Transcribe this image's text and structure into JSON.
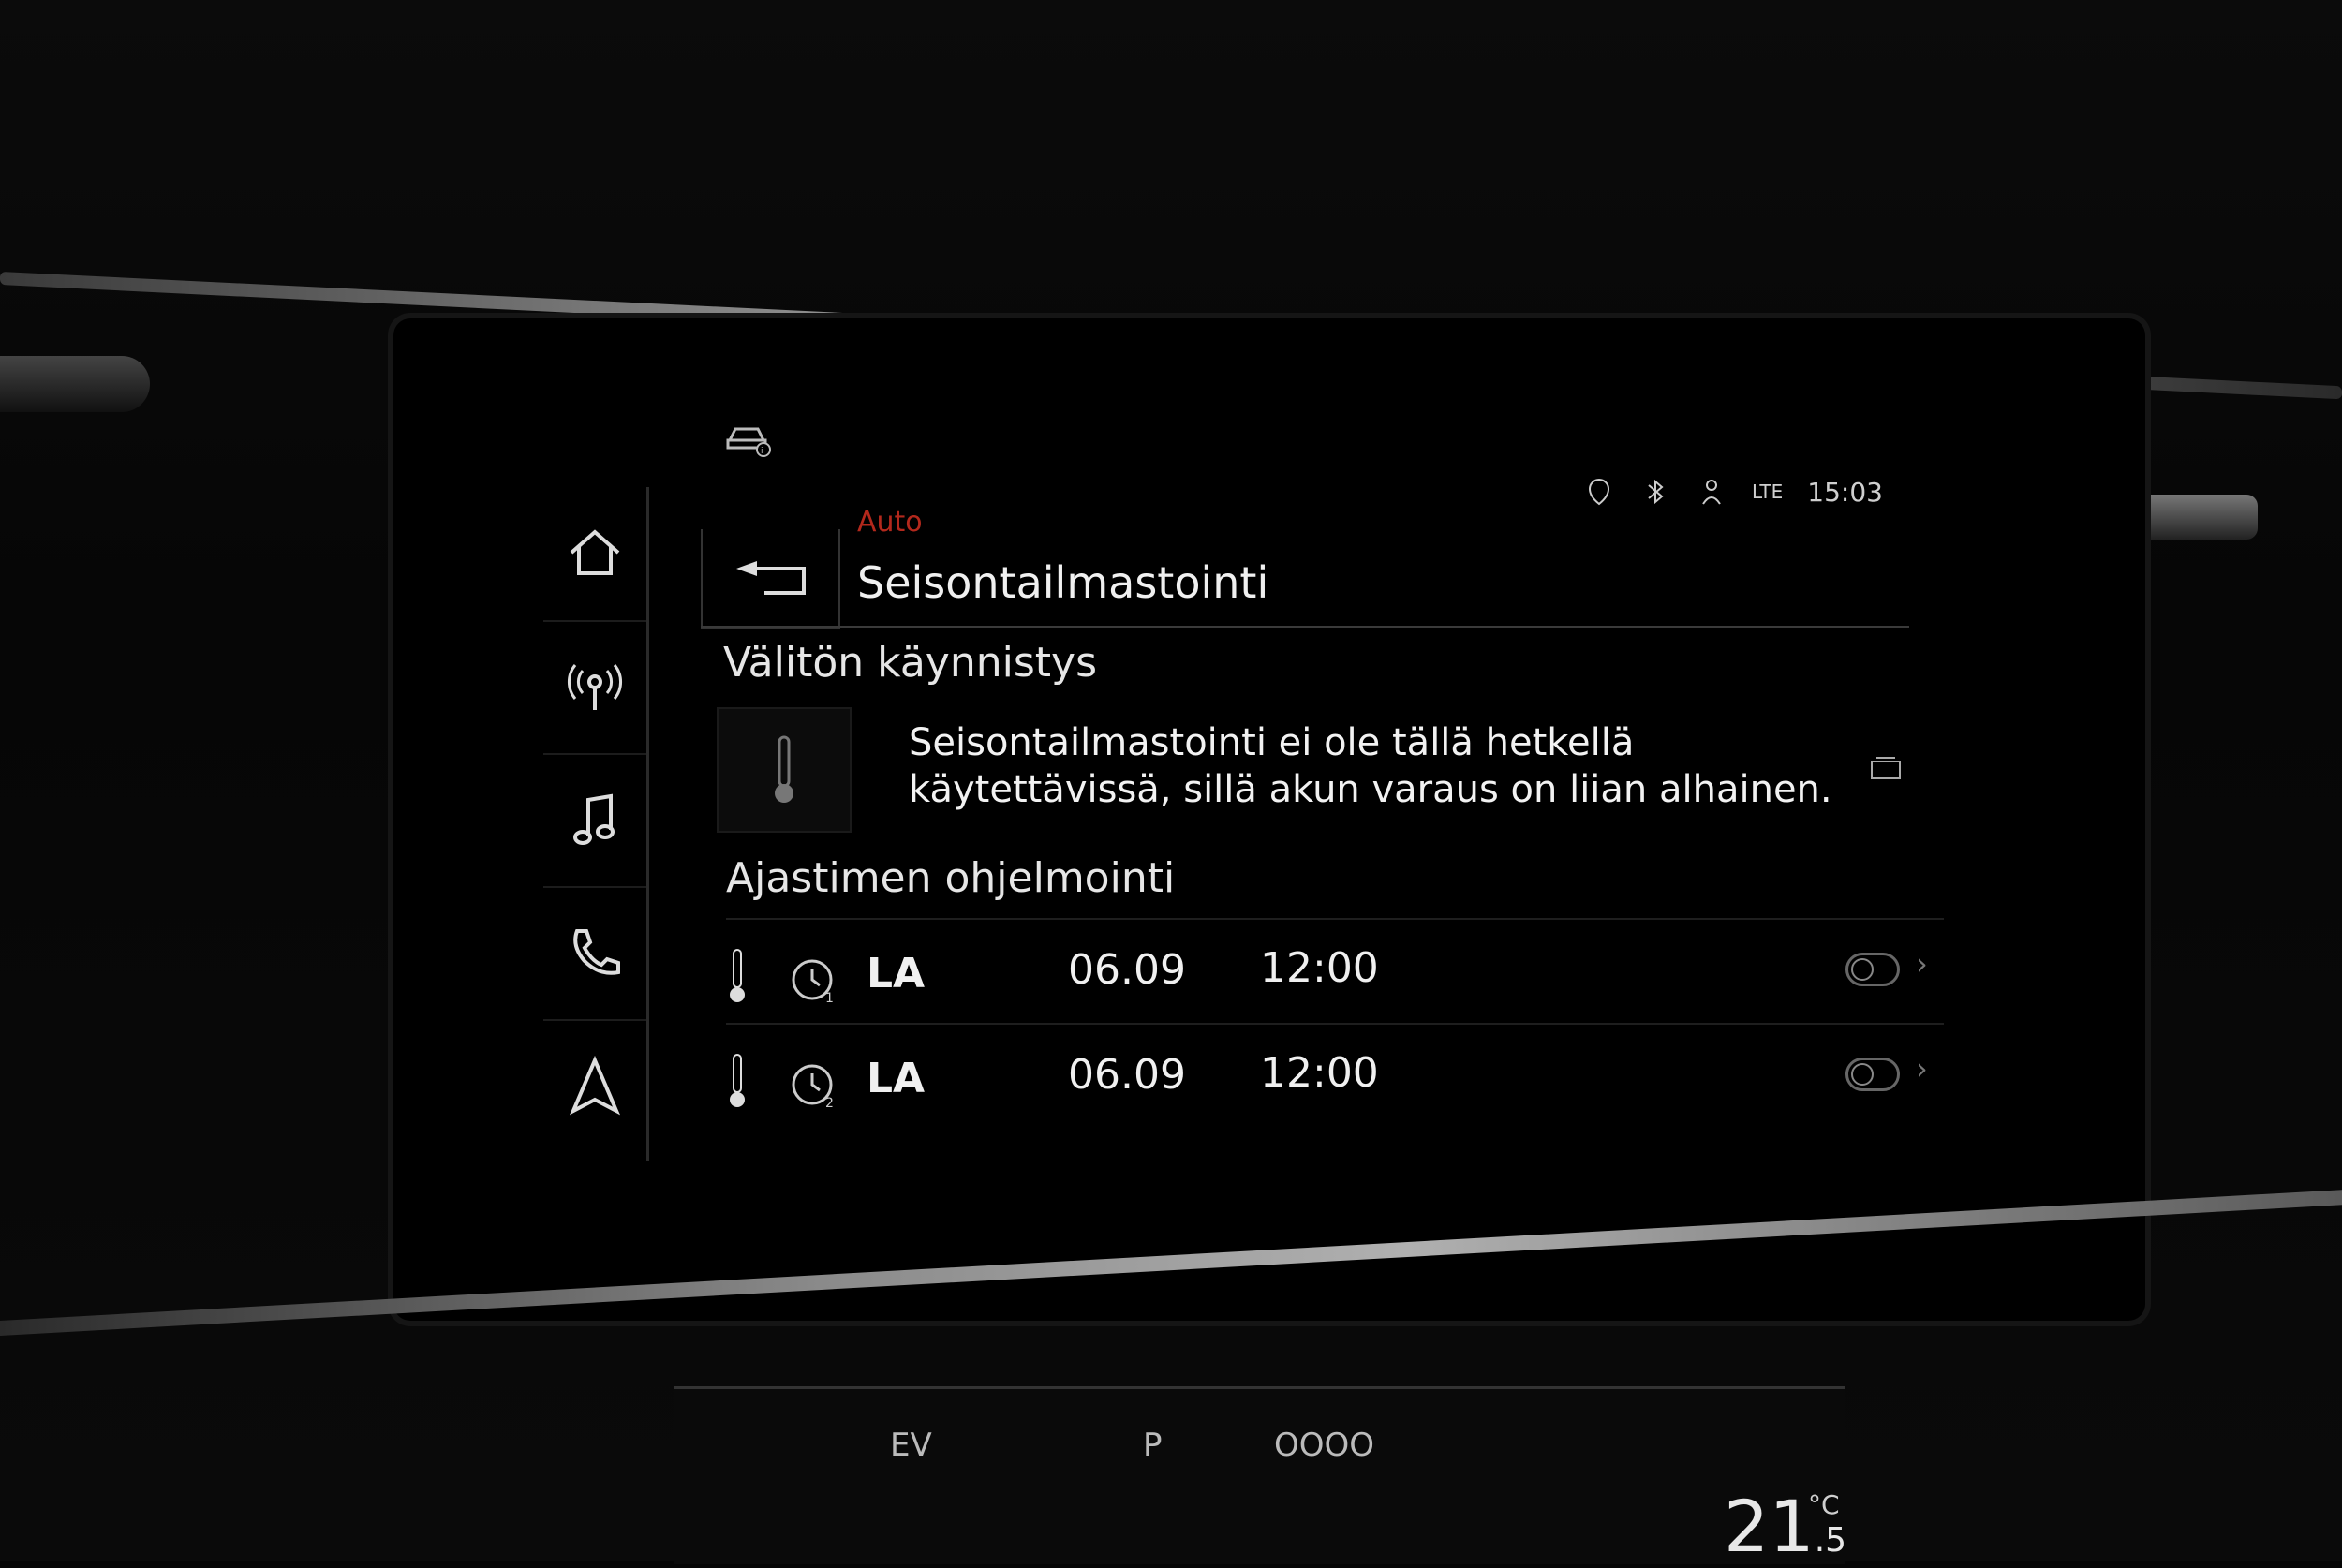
{
  "header": {
    "breadcrumb": "Auto",
    "title": "Seisontailmastointi",
    "clock": "15:03",
    "network": "LTE"
  },
  "sidebar": {
    "items": [
      {
        "icon": "home-icon"
      },
      {
        "icon": "radio-antenna-icon"
      },
      {
        "icon": "music-note-icon"
      },
      {
        "icon": "phone-icon"
      },
      {
        "icon": "navigation-arrow-icon"
      }
    ]
  },
  "instant_start": {
    "heading": "Välitön käynnistys",
    "message_line1": "Seisontailmastointi ei ole tällä hetkellä",
    "message_line2": "käytettävissä, sillä akun varaus on liian alhainen."
  },
  "timer": {
    "heading": "Ajastimen ohjelmointi",
    "rows": [
      {
        "timer_number": "1",
        "day": "LA",
        "date": "06.09",
        "time": "12:00",
        "enabled": false
      },
      {
        "timer_number": "2",
        "day": "LA",
        "date": "06.09",
        "time": "12:00",
        "enabled": false
      }
    ]
  },
  "climate": {
    "temperature": "21",
    "temperature_decimal": ".5",
    "unit": "°C",
    "labels": [
      "EV",
      "P",
      "OOOO"
    ]
  },
  "colors": {
    "accent": "#b3281c",
    "text": "#f0f0f0",
    "background": "#000000"
  }
}
